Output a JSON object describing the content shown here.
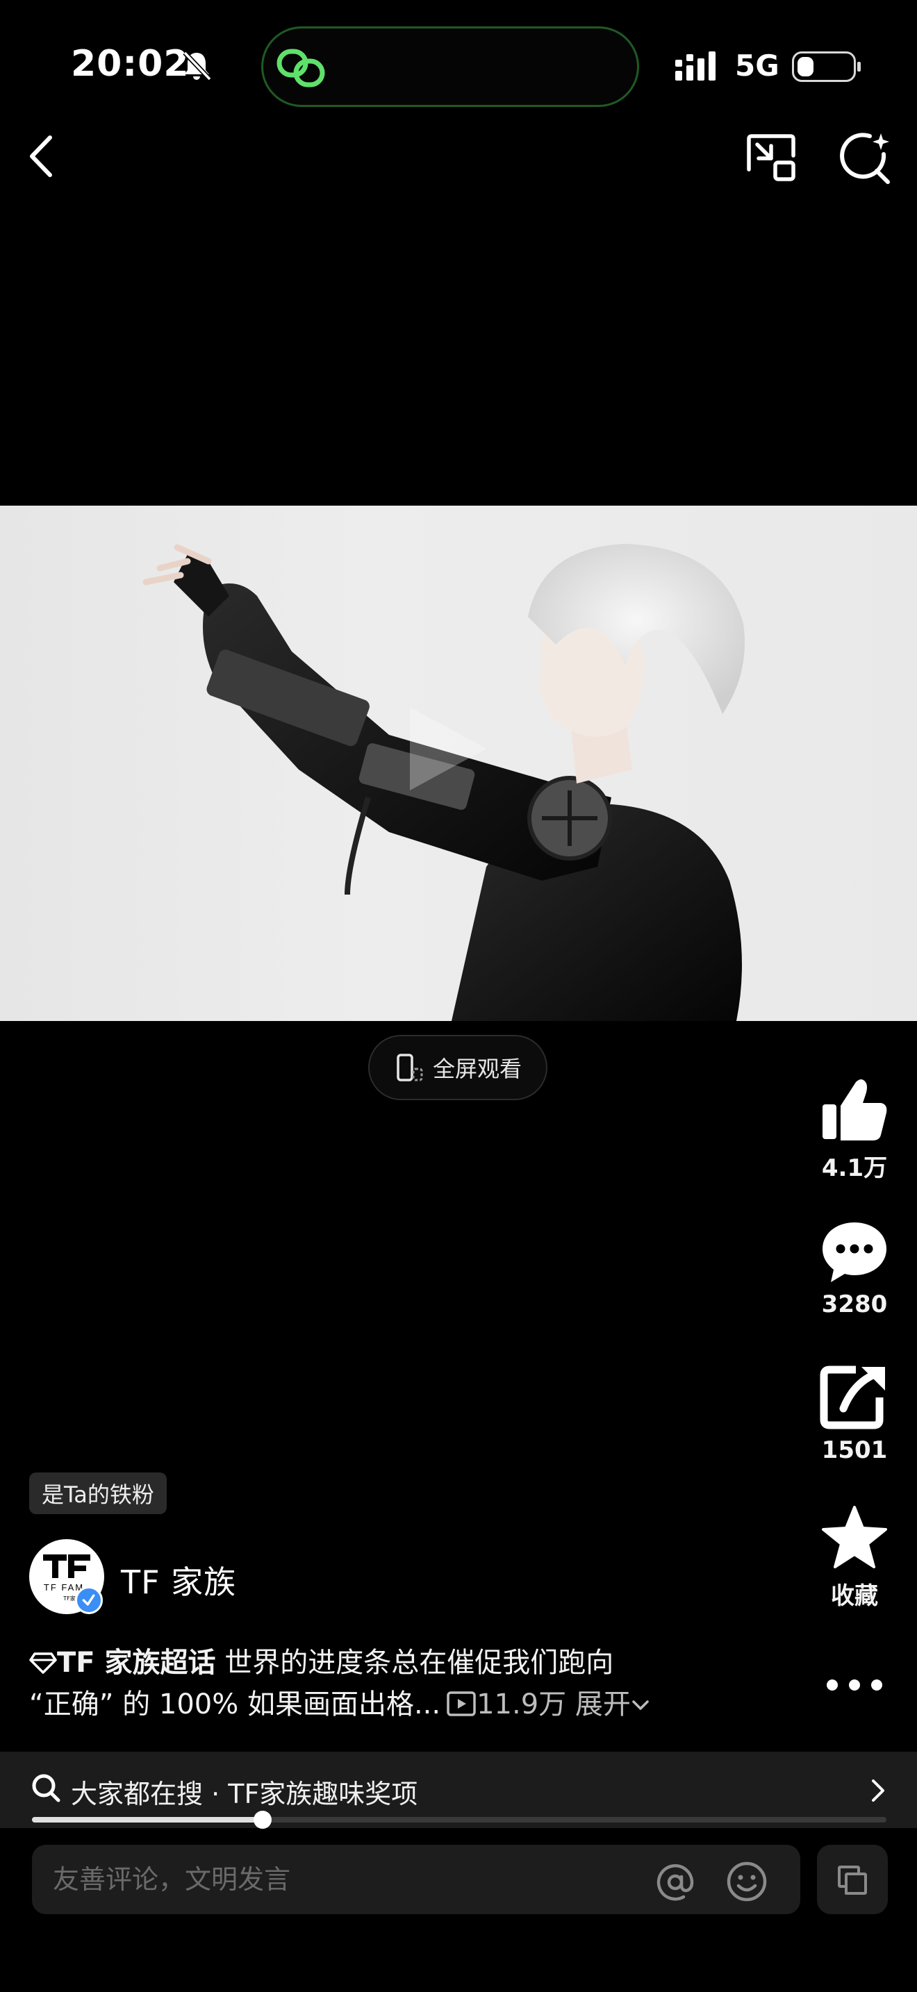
{
  "status_bar": {
    "time": "20:02",
    "network": "5G",
    "battery_level": 0.3
  },
  "video": {
    "fullscreen_label": "全屏观看",
    "progress": 0.27
  },
  "actions": {
    "like_count": "4.1万",
    "comment_count": "3280",
    "share_count": "1501",
    "favorite_label": "收藏"
  },
  "author": {
    "fan_badge": "是Ta的铁粉",
    "name": "TF 家族",
    "avatar_text": "TF FAM",
    "avatar_subtext": "TF家族"
  },
  "caption": {
    "topic": "TF 家族超话",
    "line1": " 世界的进度条总在催促我们跑向",
    "line2": "“正确” 的 100% 如果画面出格...",
    "views": "11.9万",
    "expand": "展开"
  },
  "search_suggestion": {
    "text": "大家都在搜 · TF家族趣味奖项"
  },
  "comment": {
    "placeholder": "友善评论，文明发言"
  },
  "colors": {
    "background": "#000000",
    "island_border": "#1f5a24",
    "island_icon": "#5fe06a",
    "verified": "#3a8ef5",
    "bar": "#1c1c1c"
  }
}
